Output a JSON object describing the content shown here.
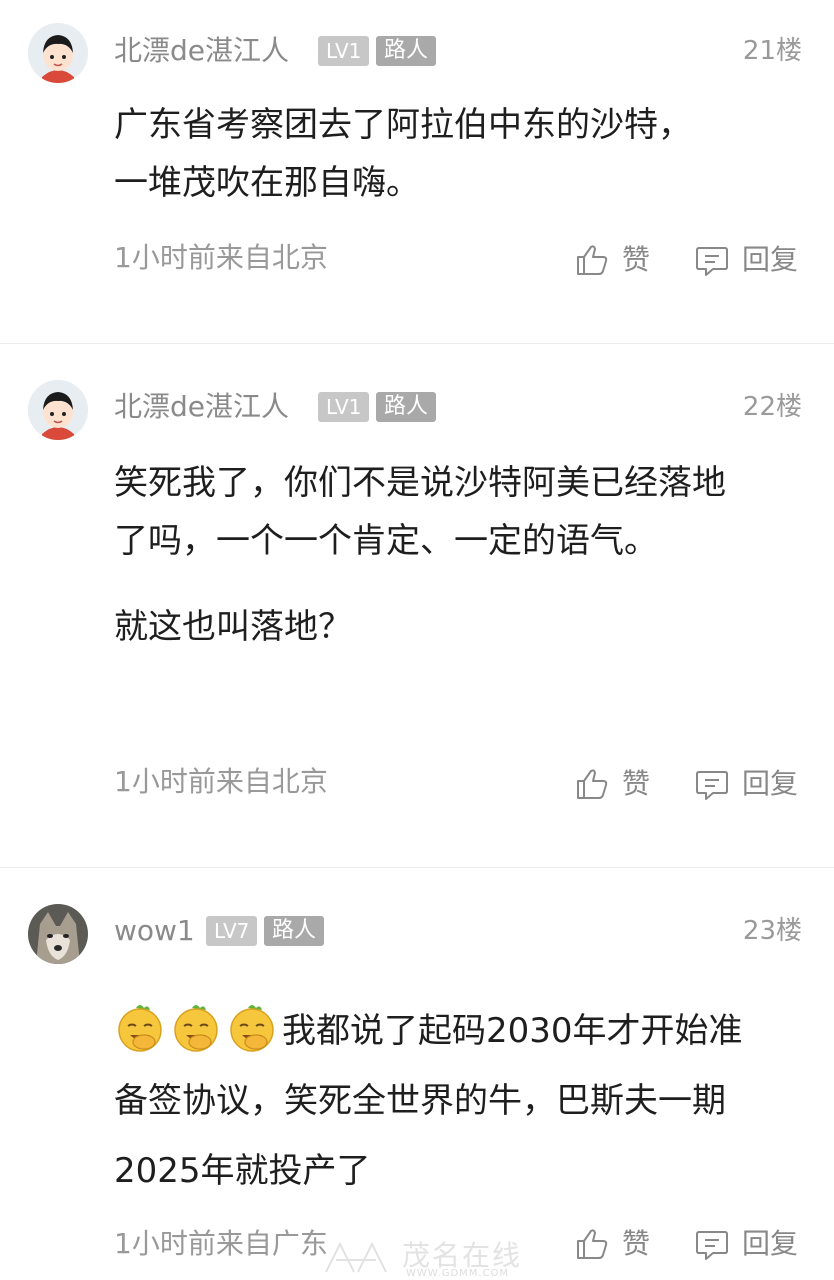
{
  "posts": [
    {
      "username": "北漂de湛江人",
      "level": "LV1",
      "role": "路人",
      "floor": "21楼",
      "content": [
        "广东省考察团去了阿拉伯中东的沙特，一堆茂吹在那自嗨。"
      ],
      "meta": "1小时前来自北京",
      "like_label": "赞",
      "reply_label": "回复"
    },
    {
      "username": "北漂de湛江人",
      "level": "LV1",
      "role": "路人",
      "floor": "22楼",
      "content": [
        "笑死我了，你们不是说沙特阿美已经落地了吗，一个一个肯定、一定的语气。",
        "就这也叫落地？"
      ],
      "meta": "1小时前来自北京",
      "like_label": "赞",
      "reply_label": "回复"
    },
    {
      "username": "wow1",
      "level": "LV7",
      "role": "路人",
      "floor": "23楼",
      "content": [
        "我都说了起码2030年才开始准备签协议，笑死全世界的牛，巴斯夫一期2025年就投产了"
      ],
      "emoji_count": 3,
      "meta": "1小时前来自广东",
      "like_label": "赞",
      "reply_label": "回复"
    }
  ],
  "watermark": {
    "main": "茂名在线",
    "sub": "WWW.GDMM.COM"
  },
  "icons": {
    "like": "thumbs-up-icon",
    "reply": "comment-icon",
    "emoji": "facepalm-emoji-icon"
  },
  "colors": {
    "text": "#1e1e1e",
    "muted": "#999999",
    "badge_level": "#c7c7c7",
    "badge_role": "#a9a9a9"
  }
}
